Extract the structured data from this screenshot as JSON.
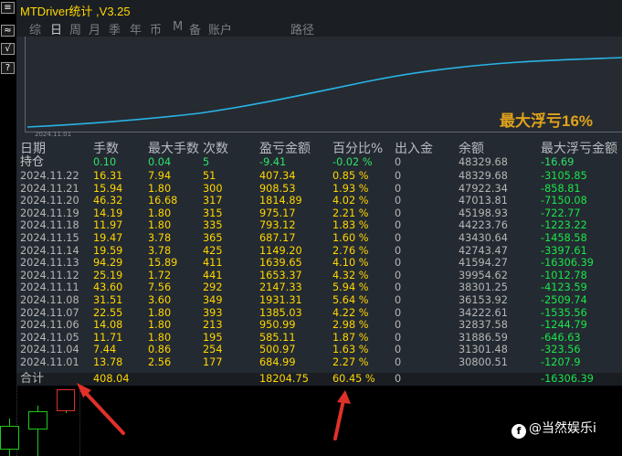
{
  "window": {
    "title": "MTDriver统计 ,V3.25"
  },
  "tabs": [
    "综",
    "日",
    "周",
    "月",
    "季",
    "年",
    "币",
    "M",
    "备",
    "账户",
    "路径"
  ],
  "active_tab": "日",
  "left_buttons": [
    "≡",
    "≈",
    "√",
    "?"
  ],
  "curve": {
    "date_label": "2024.11.01",
    "max_drawdown_label": "最大浮亏16%",
    "line_color": "#28b4e6"
  },
  "table": {
    "headers": [
      "日期",
      "手数",
      "最大手数",
      "次数",
      "盈亏金额",
      "百分比%",
      "出入金",
      "余额",
      "最大浮亏金额"
    ],
    "holding": {
      "date": "持仓",
      "lots": "0.10",
      "max": "0.04",
      "count": "5",
      "pnl": "-9.41",
      "pct": "-0.02 %",
      "io": "0",
      "balance": "48329.68",
      "dd": "-16.69"
    },
    "rows": [
      {
        "date": "2024.11.22",
        "lots": "16.31",
        "max": "7.94",
        "count": "51",
        "pnl": "407.34",
        "pct": "0.85 %",
        "io": "0",
        "balance": "48329.68",
        "dd": "-3105.85"
      },
      {
        "date": "2024.11.21",
        "lots": "15.94",
        "max": "1.80",
        "count": "300",
        "pnl": "908.53",
        "pct": "1.93 %",
        "io": "0",
        "balance": "47922.34",
        "dd": "-858.81"
      },
      {
        "date": "2024.11.20",
        "lots": "46.32",
        "max": "16.68",
        "count": "317",
        "pnl": "1814.89",
        "pct": "4.02 %",
        "io": "0",
        "balance": "47013.81",
        "dd": "-7150.08"
      },
      {
        "date": "2024.11.19",
        "lots": "14.19",
        "max": "1.80",
        "count": "315",
        "pnl": "975.17",
        "pct": "2.21 %",
        "io": "0",
        "balance": "45198.93",
        "dd": "-722.77"
      },
      {
        "date": "2024.11.18",
        "lots": "11.97",
        "max": "1.80",
        "count": "335",
        "pnl": "793.12",
        "pct": "1.83 %",
        "io": "0",
        "balance": "44223.76",
        "dd": "-1223.22"
      },
      {
        "date": "2024.11.15",
        "lots": "19.47",
        "max": "3.78",
        "count": "365",
        "pnl": "687.17",
        "pct": "1.60 %",
        "io": "0",
        "balance": "43430.64",
        "dd": "-1458.58"
      },
      {
        "date": "2024.11.14",
        "lots": "19.59",
        "max": "3.78",
        "count": "425",
        "pnl": "1149.20",
        "pct": "2.76 %",
        "io": "0",
        "balance": "42743.47",
        "dd": "-3397.61"
      },
      {
        "date": "2024.11.13",
        "lots": "94.29",
        "max": "15.89",
        "count": "411",
        "pnl": "1639.65",
        "pct": "4.10 %",
        "io": "0",
        "balance": "41594.27",
        "dd": "-16306.39"
      },
      {
        "date": "2024.11.12",
        "lots": "25.19",
        "max": "1.72",
        "count": "441",
        "pnl": "1653.37",
        "pct": "4.32 %",
        "io": "0",
        "balance": "39954.62",
        "dd": "-1012.78"
      },
      {
        "date": "2024.11.11",
        "lots": "43.60",
        "max": "7.56",
        "count": "292",
        "pnl": "2147.33",
        "pct": "5.94 %",
        "io": "0",
        "balance": "38301.25",
        "dd": "-4123.59"
      },
      {
        "date": "2024.11.08",
        "lots": "31.51",
        "max": "3.60",
        "count": "349",
        "pnl": "1931.31",
        "pct": "5.64 %",
        "io": "0",
        "balance": "36153.92",
        "dd": "-2509.74"
      },
      {
        "date": "2024.11.07",
        "lots": "22.55",
        "max": "1.80",
        "count": "393",
        "pnl": "1385.03",
        "pct": "4.22 %",
        "io": "0",
        "balance": "34222.61",
        "dd": "-1535.56"
      },
      {
        "date": "2024.11.06",
        "lots": "14.08",
        "max": "1.80",
        "count": "213",
        "pnl": "950.99",
        "pct": "2.98 %",
        "io": "0",
        "balance": "32837.58",
        "dd": "-1244.79"
      },
      {
        "date": "2024.11.05",
        "lots": "11.71",
        "max": "1.80",
        "count": "195",
        "pnl": "585.11",
        "pct": "1.87 %",
        "io": "0",
        "balance": "31886.59",
        "dd": "-646.63"
      },
      {
        "date": "2024.11.04",
        "lots": "7.44",
        "max": "0.86",
        "count": "254",
        "pnl": "500.97",
        "pct": "1.63 %",
        "io": "0",
        "balance": "31301.48",
        "dd": "-323.56"
      },
      {
        "date": "2024.11.01",
        "lots": "13.78",
        "max": "2.56",
        "count": "177",
        "pnl": "684.99",
        "pct": "2.27 %",
        "io": "0",
        "balance": "30800.51",
        "dd": "-1207.9"
      }
    ],
    "total": {
      "date": "合计",
      "lots": "408.04",
      "pnl": "18204.75",
      "pct": "60.45 %",
      "io": "0",
      "dd": "-16306.39"
    }
  },
  "watermark": "@当然娱乐i",
  "colors": {
    "title": "#ffd700",
    "accent_green": "#19e64a",
    "arrow": "#e0302a"
  }
}
